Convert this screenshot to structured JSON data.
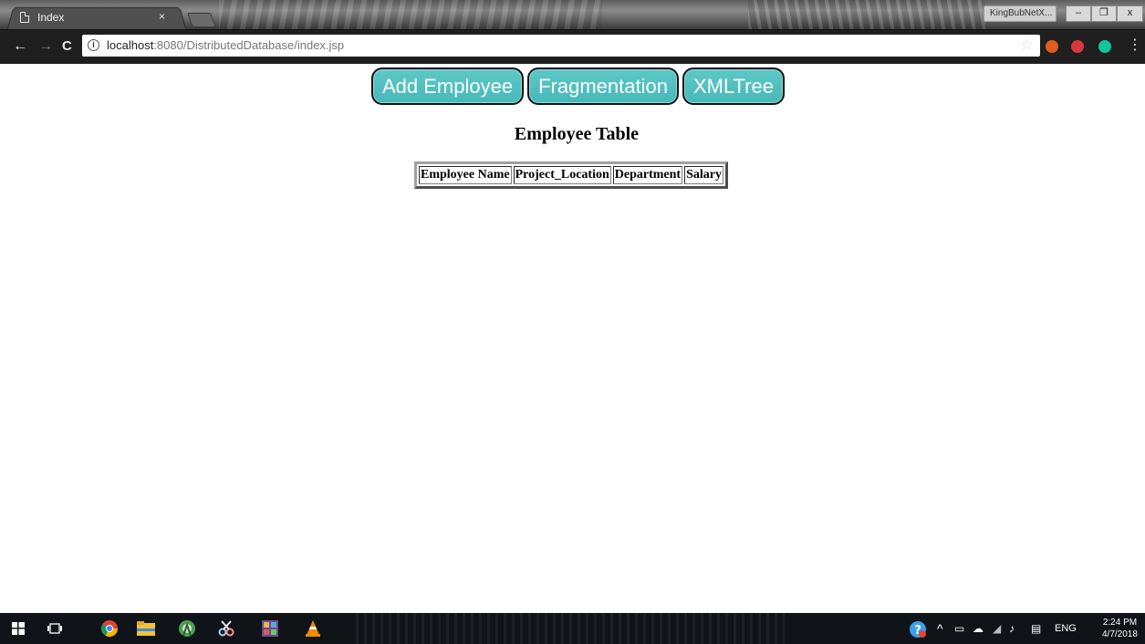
{
  "browser": {
    "tab": {
      "title": "Index",
      "close_glyph": "×"
    },
    "profile_label": "KingBubNetX...",
    "window_controls": {
      "minimize": "–",
      "restore": "❐",
      "close": "x"
    },
    "nav": {
      "back": "←",
      "forward": "→",
      "reload": "C"
    },
    "address": {
      "info_glyph": "i",
      "host": "localhost",
      "rest": ":8080/DistributedDatabase/index.jsp"
    },
    "star": "☆",
    "extensions": [
      {
        "name": "lock-extension-icon",
        "color": "#e25b1f"
      },
      {
        "name": "block-extension-icon",
        "color": "#d9363e"
      },
      {
        "name": "grammarly-extension-icon",
        "color": "#15c39a"
      }
    ],
    "menu_glyph": "⋮"
  },
  "page": {
    "buttons": [
      "Add Employee",
      "Fragmentation",
      "XMLTree"
    ],
    "title": "Employee Table",
    "table": {
      "headers": [
        "Employee Name",
        "Project_Location",
        "Department",
        "Salary"
      ]
    }
  },
  "taskbar": {
    "language": "ENG",
    "time": "2:24 PM",
    "date": "4/7/2018"
  },
  "colors": {
    "button_fill": "#4fc0c0",
    "button_border": "#111111",
    "chrome_dark": "#1f1f1f",
    "taskbar": "#101418"
  }
}
